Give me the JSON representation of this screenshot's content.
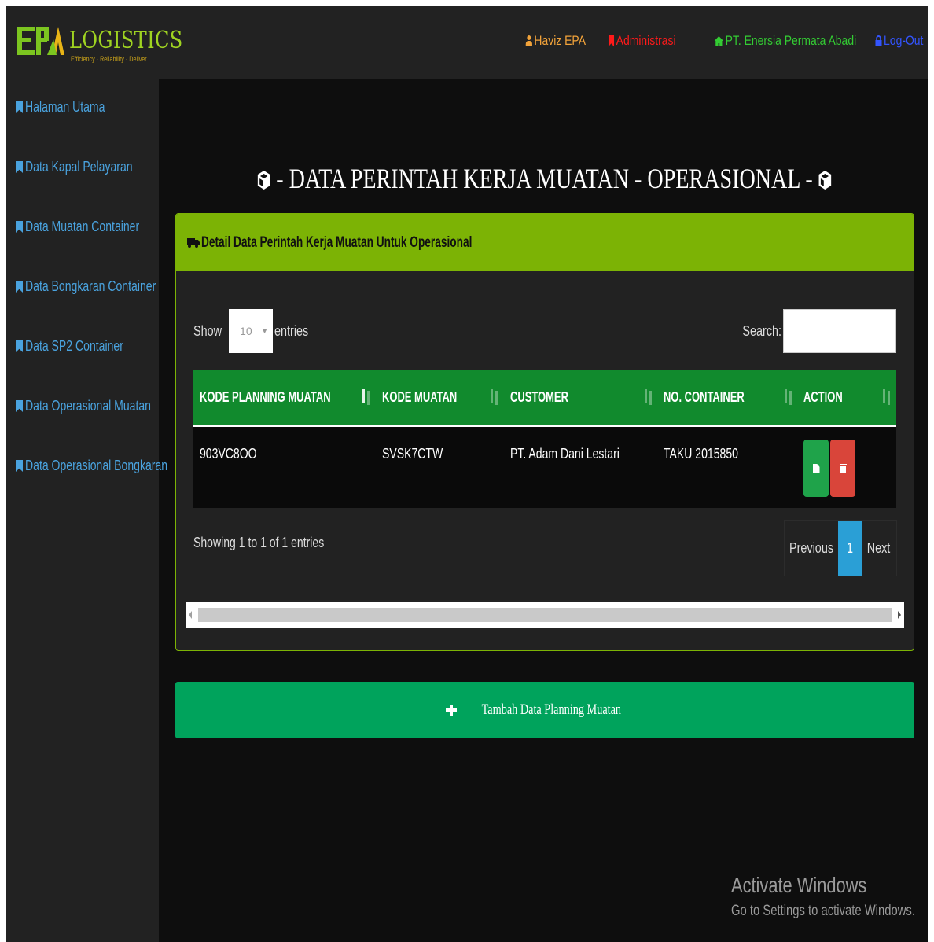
{
  "brand": {
    "name": "LOGISTICS",
    "tagline": "Efficiency · Reliability · Deliver"
  },
  "topnav": {
    "user": "Haviz EPA",
    "role": "Administrasi",
    "company": "PT. Enersia Permata Abadi",
    "logout": "Log-Out"
  },
  "sidebar": {
    "items": [
      {
        "label": "Halaman Utama"
      },
      {
        "label": "Data Kapal Pelayaran"
      },
      {
        "label": "Data Muatan Container"
      },
      {
        "label": "Data Bongkaran Container"
      },
      {
        "label": "Data SP2 Container"
      },
      {
        "label": "Data Operasional Muatan"
      },
      {
        "label": "Data Operasional Bongkaran"
      }
    ]
  },
  "page": {
    "title": " - DATA PERINTAH KERJA MUATAN - OPERASIONAL - "
  },
  "panel": {
    "heading": "Detail Data Perintah Kerja Muatan Untuk Operasional",
    "show_label": "Show",
    "entries_value": "10",
    "entries_label": "entries",
    "search_label": "Search:",
    "search_value": "",
    "columns": [
      "KODE PLANNING MUATAN",
      "KODE MUATAN",
      "CUSTOMER",
      "NO. CONTAINER",
      "ACTION"
    ],
    "rows": [
      {
        "kode_planning": "903VC8OO",
        "kode_muatan": "SVSK7CTW",
        "customer": "PT. Adam Dani Lestari",
        "no_container": "TAKU 2015850"
      }
    ],
    "info": "Showing 1 to 1 of 1 entries",
    "pagination": {
      "previous": "Previous",
      "current": "1",
      "next": "Next"
    }
  },
  "add_button": "Tambah Data Planning Muatan",
  "watermark": {
    "line1": "Activate Windows",
    "line2": "Go to Settings to activate Windows."
  },
  "colors": {
    "sidebar_link": "#4aa3df",
    "panel_head": "#7cb305",
    "table_head": "#118a2d",
    "add_button": "#00a35c",
    "user": "#f2a33a",
    "admin": "#ff1a1a",
    "company": "#33cc33",
    "logout": "#3355ff"
  }
}
